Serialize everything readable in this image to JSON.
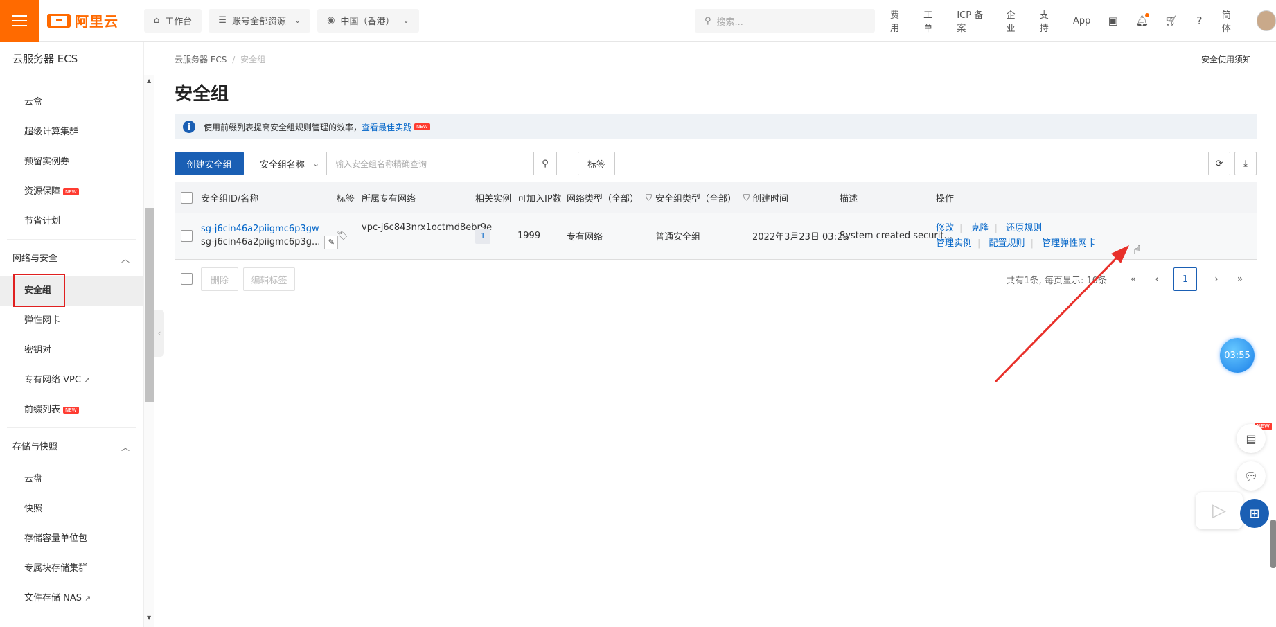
{
  "topbar": {
    "logo": "阿里云",
    "workbench": "工作台",
    "resources": "账号全部资源",
    "region": "中国（香港）",
    "search_placeholder": "搜索...",
    "links": [
      "费用",
      "工单",
      "ICP 备案",
      "企业",
      "支持",
      "App"
    ],
    "lang": "简体"
  },
  "sidebar": {
    "title": "云服务器 ECS",
    "items_top": [
      "云盒",
      "超级计算集群",
      "预留实例券",
      "资源保障",
      "节省计划"
    ],
    "new_badge": "NEW",
    "group_network": "网络与安全",
    "network_items": [
      "安全组",
      "弹性网卡",
      "密钥对",
      "专有网络 VPC",
      "前缀列表"
    ],
    "group_storage": "存储与快照",
    "storage_items": [
      "云盘",
      "快照",
      "存储容量单位包",
      "专属块存储集群",
      "文件存储 NAS"
    ]
  },
  "breadcrumb": {
    "root": "云服务器 ECS",
    "sep": "/",
    "current": "安全组"
  },
  "notice_link": "安全使用须知",
  "page_title": "安全组",
  "info": {
    "text": "使用前缀列表提高安全组规则管理的效率，",
    "link": "查看最佳实践",
    "badge": "NEW"
  },
  "toolbar": {
    "create": "创建安全组",
    "filter_select": "安全组名称",
    "input_placeholder": "输入安全组名称精确查询",
    "tag_button": "标签"
  },
  "table": {
    "headers": [
      "安全组ID/名称",
      "标签",
      "所属专有网络",
      "相关实例",
      "可加入IP数",
      "网络类型（全部）",
      "安全组类型（全部）",
      "创建时间",
      "描述",
      "操作"
    ],
    "row": {
      "id": "sg-j6cin46a2piigmc6p3gw",
      "name": "sg-j6cin46a2piigmc6p3g...",
      "vpc": "vpc-j6c843nrx1octmd8ebr9e",
      "instances": "1",
      "ip_count": "1999",
      "net_type": "专有网络",
      "sg_type": "普通安全组",
      "created": "2022年3月23日 03:29",
      "desc": "System created securit...",
      "ops_line1": [
        "修改",
        "克隆",
        "还原规则"
      ],
      "ops_line2": [
        "管理实例",
        "配置规则",
        "管理弹性网卡"
      ]
    }
  },
  "footer": {
    "delete": "删除",
    "edit_tags": "编辑标签",
    "total_text": "共有1条, 每页显示: 10条",
    "current_page": "1"
  },
  "timer": "03:55",
  "float_new": "NEW",
  "colors": {
    "brand": "#ff6a00",
    "primary": "#1a5fb4",
    "link": "#0064c8",
    "highlight": "#e02020"
  }
}
